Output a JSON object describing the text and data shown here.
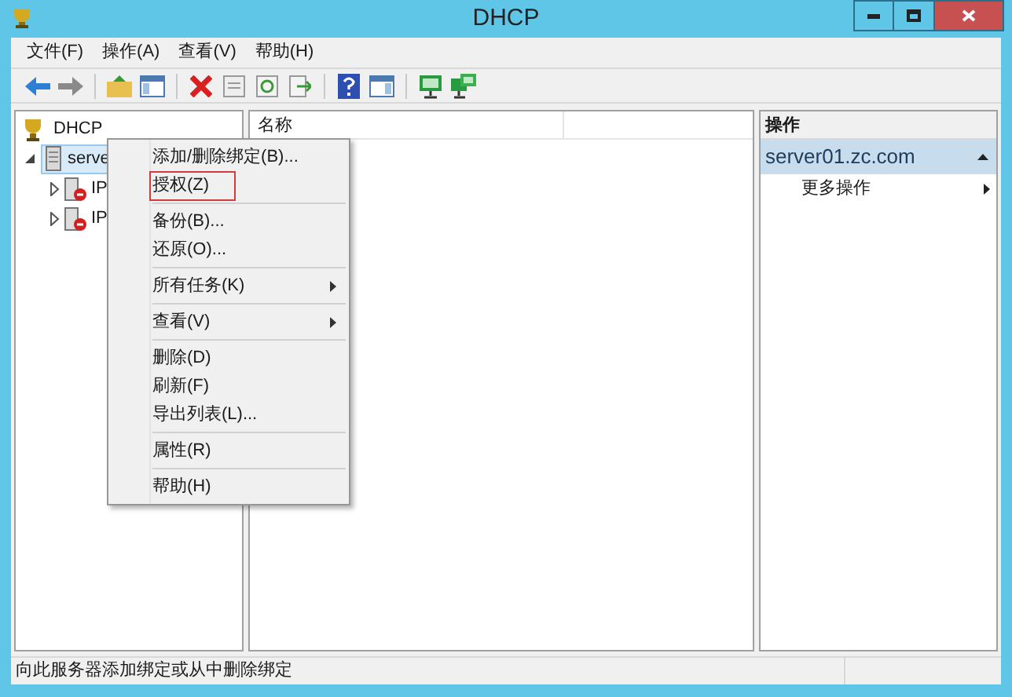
{
  "window": {
    "title": "DHCP"
  },
  "menu_bar": [
    "文件(F)",
    "操作(A)",
    "查看(V)",
    "帮助(H)"
  ],
  "tree": {
    "label": "DHCP",
    "expanded": true,
    "children": [
      {
        "label": "serve",
        "expanded": true,
        "selected": true,
        "children": [
          {
            "label": "IP",
            "expanded": false
          },
          {
            "label": "IP",
            "expanded": false
          }
        ]
      }
    ]
  },
  "list": {
    "columns": [
      "名称"
    ]
  },
  "actions": {
    "title": "操作",
    "section": "server01.zc.com",
    "items": [
      "更多操作"
    ]
  },
  "context_menu": [
    {
      "kind": "item",
      "label": "添加/删除绑定(B)...",
      "highlighted": false
    },
    {
      "kind": "item",
      "label": "授权(Z)",
      "highlighted": true
    },
    {
      "kind": "separator"
    },
    {
      "kind": "item",
      "label": "备份(B)...",
      "highlighted": false
    },
    {
      "kind": "item",
      "label": "还原(O)...",
      "highlighted": false
    },
    {
      "kind": "separator"
    },
    {
      "kind": "submenu",
      "label": "所有任务(K)",
      "highlighted": false
    },
    {
      "kind": "separator"
    },
    {
      "kind": "submenu",
      "label": "查看(V)",
      "highlighted": false
    },
    {
      "kind": "separator"
    },
    {
      "kind": "item",
      "label": "删除(D)",
      "highlighted": false
    },
    {
      "kind": "item",
      "label": "刷新(F)",
      "highlighted": false
    },
    {
      "kind": "item",
      "label": "导出列表(L)...",
      "highlighted": false
    },
    {
      "kind": "separator"
    },
    {
      "kind": "item",
      "label": "属性(R)",
      "highlighted": false
    },
    {
      "kind": "separator"
    },
    {
      "kind": "item",
      "label": "帮助(H)",
      "highlighted": false
    }
  ],
  "status_bar": "向此服务器添加绑定或从中删除绑定"
}
